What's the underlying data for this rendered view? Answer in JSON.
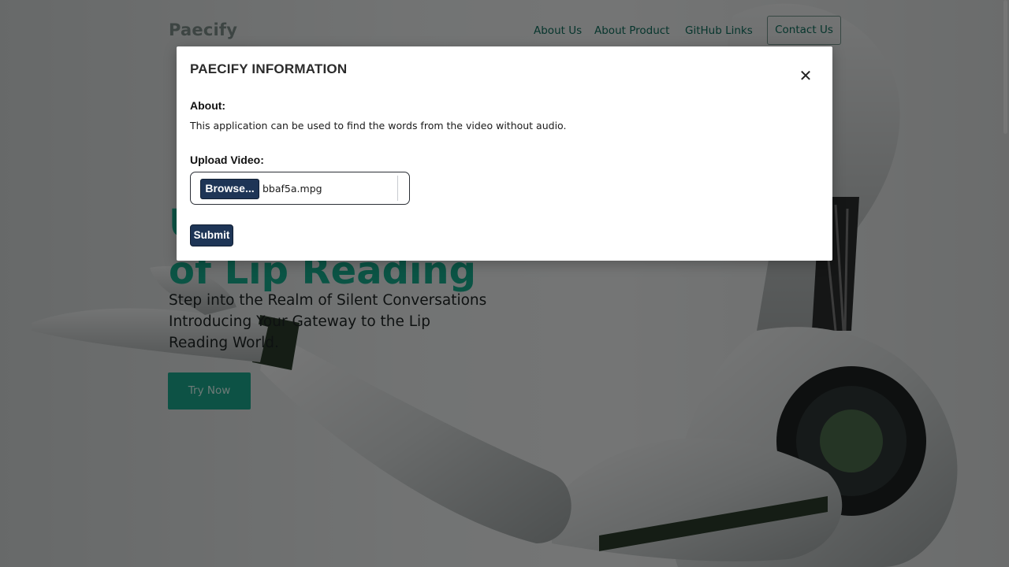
{
  "navbar": {
    "brand": "Paecify",
    "links": [
      "About Us",
      "About Product",
      "GitHub Links"
    ],
    "contact": "Contact Us"
  },
  "hero": {
    "title_line1": "U",
    "title_line2": "of Lip Reading",
    "subtitle": "Step into the Realm of Silent Conversations Introducing Your Gateway to the Lip Reading World.",
    "cta": "Try Now"
  },
  "modal": {
    "title": "PAECIFY INFORMATION",
    "close_icon": "✕",
    "about_label": "About:",
    "about_text": "This application can be used to find the words from the video without audio.",
    "upload_label": "Upload Video:",
    "browse_label": "Browse...",
    "file_name": "bbaf5a.mpg",
    "submit_label": "Submit"
  },
  "colors": {
    "accent": "#1aa58a",
    "button_dark": "#1e3556",
    "overlay": "rgba(0,0,0,0.5)"
  },
  "icons": {
    "close": "close-icon",
    "robot": "robot-illustration"
  }
}
